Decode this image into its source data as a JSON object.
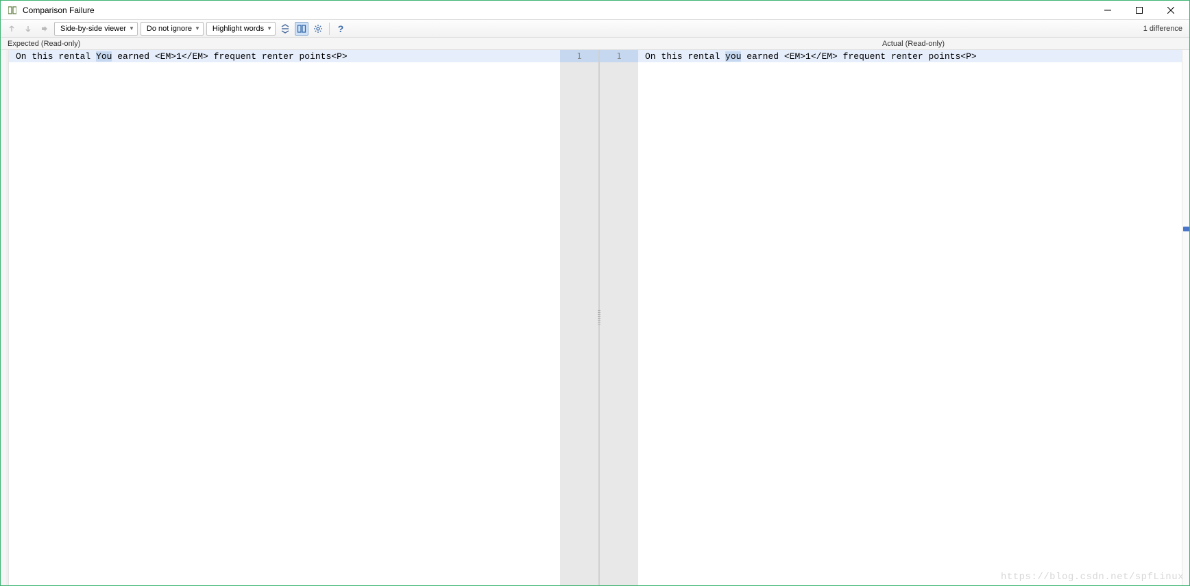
{
  "title": "Comparison Failure",
  "toolbar": {
    "viewer_mode": "Side-by-side viewer",
    "ignore_mode": "Do not ignore",
    "highlight_mode": "Highlight words",
    "diff_count": "1 difference"
  },
  "headers": {
    "expected": "Expected (Read-only)",
    "actual": "Actual (Read-only)"
  },
  "diff": {
    "line_number_left": "1",
    "line_number_right": "1",
    "expected": {
      "pre": "On this rental ",
      "hl": "You",
      "post": " earned <EM>1</EM> frequent renter points<P>"
    },
    "actual": {
      "pre": "On this rental ",
      "hl": "you",
      "post": " earned <EM>1</EM> frequent renter points<P>"
    }
  },
  "watermark": "https://blog.csdn.net/spfLinux"
}
